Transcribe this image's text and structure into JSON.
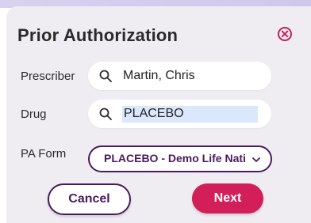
{
  "dialog": {
    "title": "Prior Authorization",
    "close_icon": "close-icon"
  },
  "fields": {
    "prescriber": {
      "label": "Prescriber",
      "value": "Martin, Chris",
      "icon": "search-icon"
    },
    "drug": {
      "label": "Drug",
      "value": "PLACEBO",
      "icon": "search-icon"
    },
    "pa_form": {
      "label": "PA Form",
      "value": "PLACEBO - Demo Life Natic",
      "icon": "chevron-down-icon"
    }
  },
  "buttons": {
    "cancel": "Cancel",
    "next": "Next"
  },
  "colors": {
    "accent": "#d21f5a",
    "outline": "#4a1a5e",
    "panel": "#efedf2"
  }
}
